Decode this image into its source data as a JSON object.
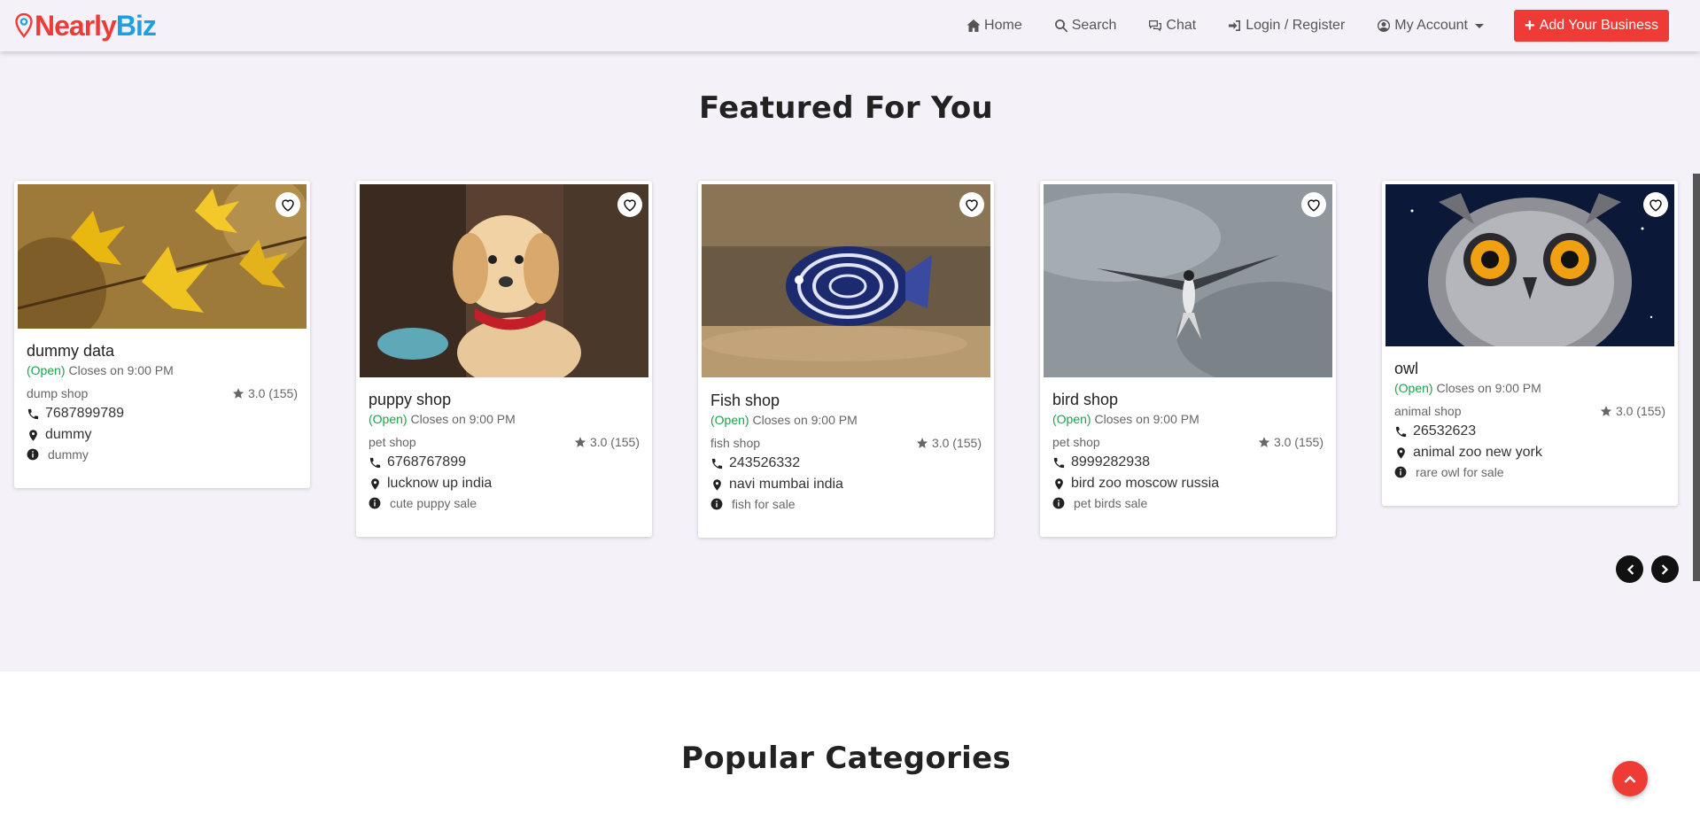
{
  "brand": {
    "part1": "Nearly",
    "part2": "Biz"
  },
  "nav": {
    "home": "Home",
    "search": "Search",
    "chat": "Chat",
    "login": "Login / Register",
    "account": "My Account",
    "add_business": "Add Your Business"
  },
  "featured": {
    "title": "Featured For You",
    "cards": [
      {
        "title": "dummy data",
        "status": "(Open)",
        "hours": "Closes on 9:00 PM",
        "category": "dump shop",
        "rating": "3.0 (155)",
        "phone": "7687899789",
        "address": "dummy",
        "info": "dummy",
        "image": "yellow-leaves"
      },
      {
        "title": "puppy shop",
        "status": "(Open)",
        "hours": "Closes on 9:00 PM",
        "category": "pet shop",
        "rating": "3.0 (155)",
        "phone": "6768767899",
        "address": "lucknow up india",
        "info": "cute puppy sale",
        "image": "puppy"
      },
      {
        "title": "Fish shop",
        "status": "(Open)",
        "hours": "Closes on 9:00 PM",
        "category": "fish shop",
        "rating": "3.0 (155)",
        "phone": "243526332",
        "address": "navi mumbai india",
        "info": "fish for sale",
        "image": "angelfish"
      },
      {
        "title": "bird shop",
        "status": "(Open)",
        "hours": "Closes on 9:00 PM",
        "category": "pet shop",
        "rating": "3.0 (155)",
        "phone": "8999282938",
        "address": "bird zoo moscow russia",
        "info": "pet birds sale",
        "image": "tern-bird"
      },
      {
        "title": "owl",
        "status": "(Open)",
        "hours": "Closes on 9:00 PM",
        "category": "animal shop",
        "rating": "3.0 (155)",
        "phone": "26532623",
        "address": "animal zoo new york",
        "info": "rare owl for sale",
        "image": "owl"
      }
    ]
  },
  "popular": {
    "title": "Popular Categories"
  },
  "colors": {
    "accent": "#ef3b36",
    "brand_blue": "#1ea0e0",
    "open": "#1aa34a",
    "section_bg": "#f4f2f8"
  }
}
